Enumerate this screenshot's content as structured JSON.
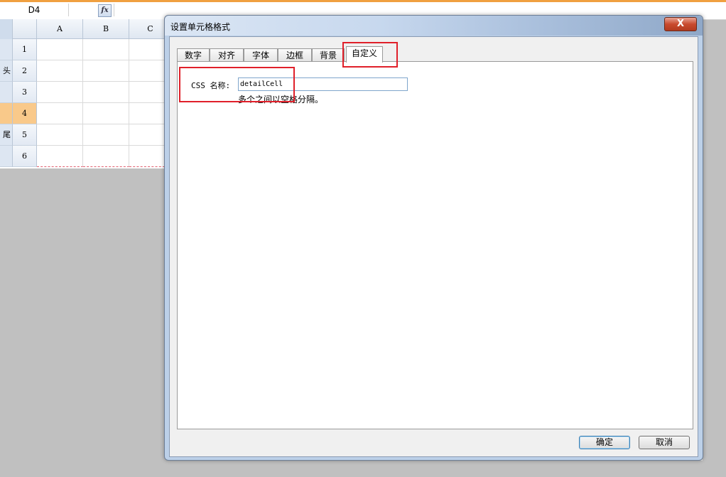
{
  "formula_bar": {
    "name_box": "D4",
    "fx_label": "fx"
  },
  "sheet": {
    "columns": [
      "A",
      "B",
      "C"
    ],
    "rows": [
      {
        "num": "1",
        "label": ""
      },
      {
        "num": "2",
        "label": "头"
      },
      {
        "num": "3",
        "label": ""
      },
      {
        "num": "4",
        "label": ""
      },
      {
        "num": "5",
        "label": "尾"
      },
      {
        "num": "6",
        "label": ""
      }
    ],
    "selected_row": "4"
  },
  "dialog": {
    "title": "设置单元格格式",
    "close_label": "X",
    "tabs": [
      {
        "label": "数字"
      },
      {
        "label": "对齐"
      },
      {
        "label": "字体"
      },
      {
        "label": "边框"
      },
      {
        "label": "背景"
      },
      {
        "label": "自定义"
      }
    ],
    "active_tab": "自定义",
    "css_label": "CSS 名称:",
    "css_value": "detailCell",
    "hint": "多个之间以空格分隔。",
    "ok_label": "确定",
    "cancel_label": "取消"
  },
  "colors": {
    "highlight_box": "#e0202a",
    "selected_row": "#f9c98a"
  }
}
